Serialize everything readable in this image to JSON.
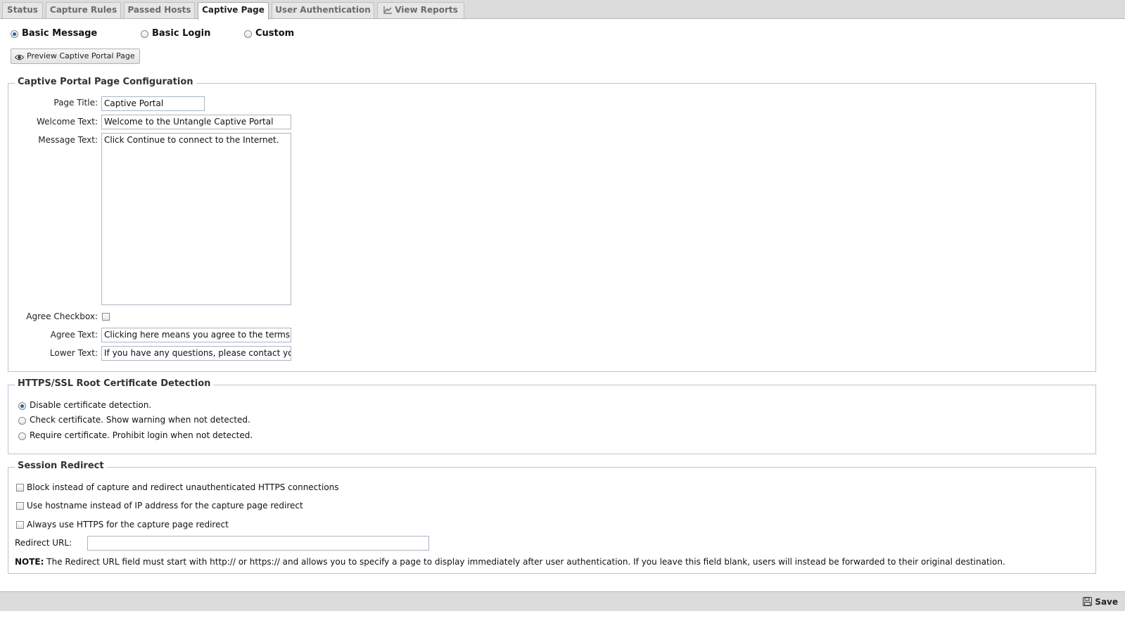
{
  "tabs": [
    {
      "label": "Status"
    },
    {
      "label": "Capture Rules"
    },
    {
      "label": "Passed Hosts"
    },
    {
      "label": "Captive Page"
    },
    {
      "label": "User Authentication"
    },
    {
      "label": "View Reports",
      "icon": "chart-icon"
    }
  ],
  "page_mode": {
    "options": [
      "Basic Message",
      "Basic Login",
      "Custom"
    ],
    "selected": "Basic Message"
  },
  "preview_button": {
    "label": "Preview Captive Portal Page",
    "icon": "eye-icon"
  },
  "config": {
    "legend": "Captive Portal Page Configuration",
    "page_title_label": "Page Title:",
    "page_title_value": "Captive Portal",
    "welcome_label": "Welcome Text:",
    "welcome_value": "Welcome to the Untangle Captive Portal",
    "message_label": "Message Text:",
    "message_value": "Click Continue to connect to the Internet.",
    "agree_checkbox_label": "Agree Checkbox:",
    "agree_checked": false,
    "agree_text_label": "Agree Text:",
    "agree_text_value": "Clicking here means you agree to the terms above.",
    "lower_text_label": "Lower Text:",
    "lower_text_value": "If you have any questions, please contact your network administrator."
  },
  "cert": {
    "legend": "HTTPS/SSL Root Certificate Detection",
    "options": [
      "Disable certificate detection.",
      "Check certificate. Show warning when not detected.",
      "Require certificate. Prohibit login when not detected."
    ],
    "selected": 0
  },
  "session": {
    "legend": "Session Redirect",
    "checkboxes": [
      "Block instead of capture and redirect unauthenticated HTTPS connections",
      "Use hostname instead of IP address for the capture page redirect",
      "Always use HTTPS for the capture page redirect"
    ],
    "redirect_label": "Redirect URL:",
    "redirect_value": "",
    "note_bold": "NOTE:",
    "note_text": "The Redirect URL field must start with http:// or https:// and allows you to specify a page to display immediately after user authentication. If you leave this field blank, users will instead be forwarded to their original destination."
  },
  "footer": {
    "save_label": "Save",
    "save_icon": "floppy-icon"
  },
  "colors": {
    "fieldset_border": "#b8c6d6",
    "bar_bg": "#dcdcdc",
    "radio_dot": "#2b5ea8"
  }
}
